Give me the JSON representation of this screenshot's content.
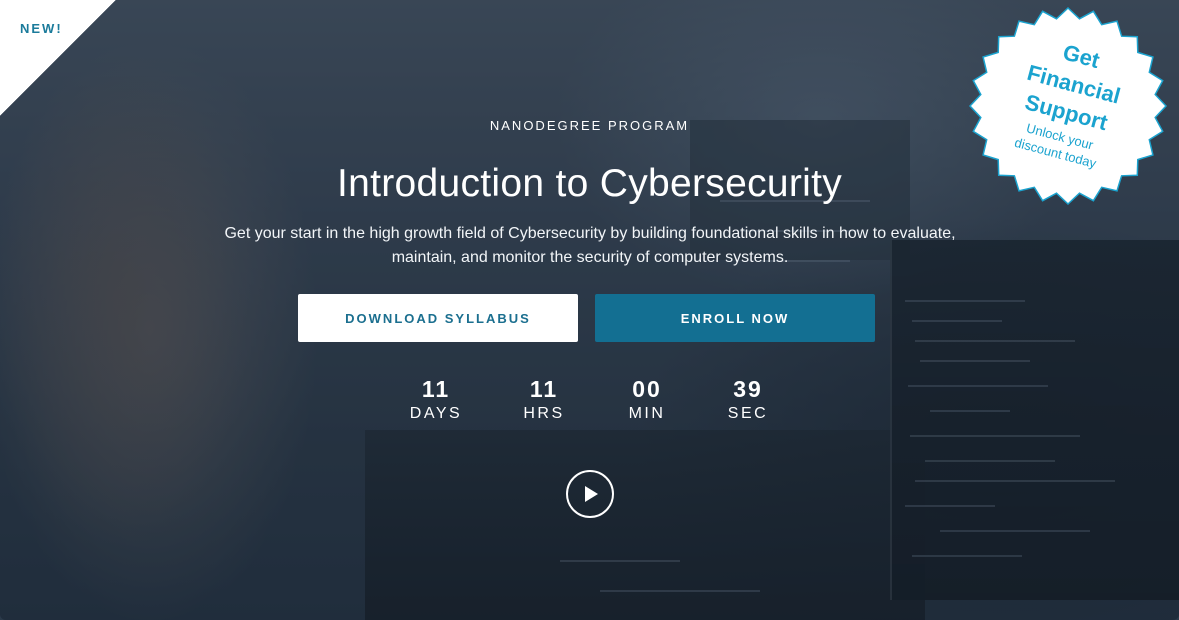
{
  "corner_badge": {
    "label": "NEW!"
  },
  "hero": {
    "eyebrow": "NANODEGREE PROGRAM",
    "title": "Introduction to Cybersecurity",
    "subtitle_line1": "Get your start in the high growth field of Cybersecurity by building foundational skills in how to evaluate,",
    "subtitle_line2": "maintain, and monitor the security of computer systems."
  },
  "buttons": {
    "download_syllabus": "DOWNLOAD SYLLABUS",
    "enroll_now": "ENROLL NOW"
  },
  "countdown": {
    "days": {
      "value": "11",
      "label": "DAYS"
    },
    "hours": {
      "value": "11",
      "label": "HRS"
    },
    "minutes": {
      "value": "00",
      "label": "MIN"
    },
    "seconds": {
      "value": "39",
      "label": "SEC"
    }
  },
  "financial_badge": {
    "line1": "Get",
    "line2": "Financial",
    "line3": "Support",
    "sub1": "Unlock your",
    "sub2": "discount today"
  },
  "icons": {
    "play": "play-icon"
  },
  "colors": {
    "accent": "#136f92",
    "badge_text": "#1ba3cf",
    "new_label": "#1b7b9b"
  }
}
